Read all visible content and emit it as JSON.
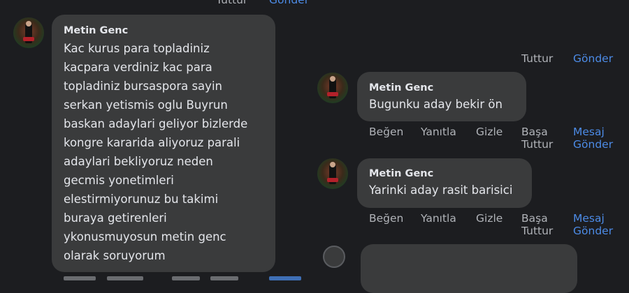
{
  "top_actions": {
    "tuttur": "Tuttur",
    "gonder": "Gönder"
  },
  "mid_actions_top": {
    "tuttur": "Tuttur",
    "gonder": "Gönder"
  },
  "left_comment": {
    "author": "Metin Genc",
    "lines": [
      "Kac kurus para topladiniz",
      "kacpara verdiniz kac para",
      "topladiniz bursaspora sayin",
      "serkan yetismis oglu Buyrun",
      "baskan adaylari geliyor bizlerde",
      "kongre kararida aliyoruz parali",
      "adaylari bekliyoruz neden",
      "gecmis yonetimleri",
      "elestirmiyorunuz bu takimi",
      "buraya getirenleri",
      "ykonusmuyosun metin genc",
      "olarak soruyorum"
    ]
  },
  "reply1": {
    "author": "Metin Genc",
    "text": "Bugunku aday bekir ön",
    "actions": {
      "like": "Beğen",
      "reply": "Yanıtla",
      "hide": "Gizle",
      "pin_1": "Başa",
      "pin_2": "Tuttur",
      "msg_1": "Mesaj",
      "msg_2": "Gönder"
    }
  },
  "reply2": {
    "author": "Metin Genc",
    "text": "Yarinki aday rasit barisici",
    "actions": {
      "like": "Beğen",
      "reply": "Yanıtla",
      "hide": "Gizle",
      "pin_1": "Başa",
      "pin_2": "Tuttur",
      "msg_1": "Mesaj",
      "msg_2": "Gönder"
    }
  },
  "colors": {
    "background": "#1c1d20",
    "bubble": "#3a3b3c",
    "text": "#e4e6eb",
    "secondary": "#b0b3b8",
    "link": "#4c8be6"
  }
}
